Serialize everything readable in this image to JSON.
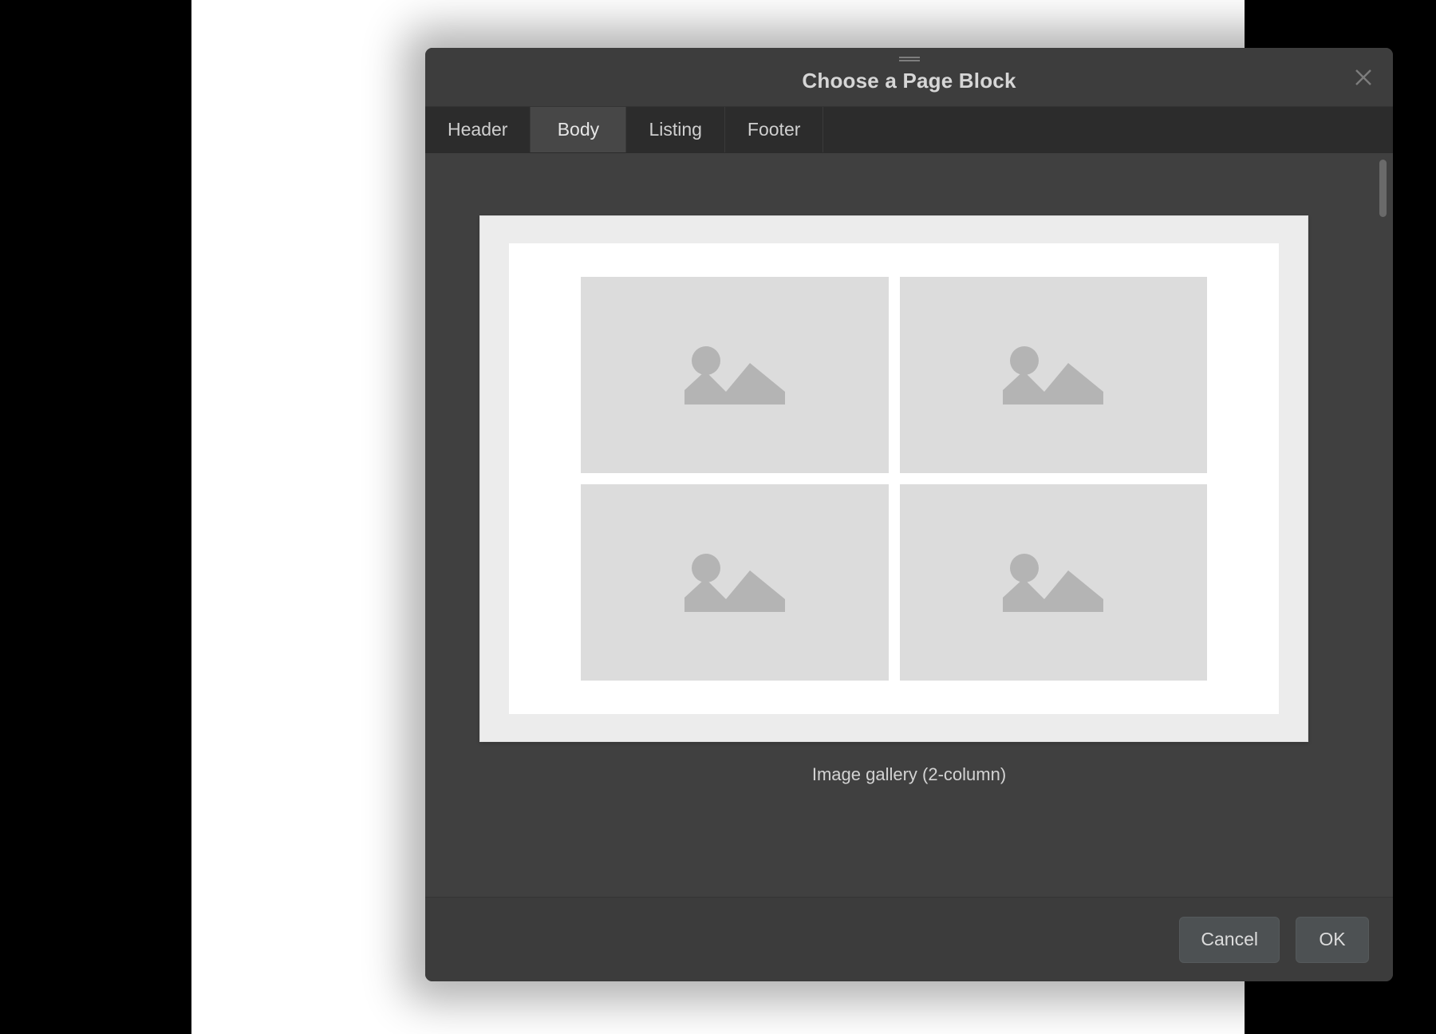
{
  "dialog": {
    "title": "Choose a Page Block",
    "grabber_icon": "drag-handle-icon",
    "close_icon": "close-icon"
  },
  "tabs": [
    {
      "label": "Header",
      "selected": false
    },
    {
      "label": "Body",
      "selected": true
    },
    {
      "label": "Listing",
      "selected": false
    },
    {
      "label": "Footer",
      "selected": false
    }
  ],
  "preview": {
    "caption": "Image gallery (2-column)",
    "layout": "2-column grid",
    "tiles": [
      {
        "placeholder_icon": "image-placeholder-icon"
      },
      {
        "placeholder_icon": "image-placeholder-icon"
      },
      {
        "placeholder_icon": "image-placeholder-icon"
      },
      {
        "placeholder_icon": "image-placeholder-icon"
      }
    ]
  },
  "scrollbar": {
    "orientation": "vertical",
    "position": "top"
  },
  "footer": {
    "cancel_label": "Cancel",
    "ok_label": "OK"
  },
  "colors": {
    "dialog_bg": "#3d3d3d",
    "tabstrip_bg": "#2c2c2c",
    "tab_selected_bg": "#474747",
    "content_bg": "#404040",
    "card_bg": "#ececec",
    "page_bg": "#ffffff",
    "tile_bg": "#dcdcdc",
    "tile_icon": "#b4b4b4",
    "text_primary": "#d6d6d6",
    "button_bg": "#4d5153"
  }
}
